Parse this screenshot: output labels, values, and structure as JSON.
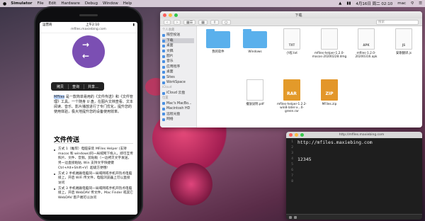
{
  "menubar": {
    "app_name": "Simulator",
    "items": [
      "File",
      "Edit",
      "Hardware",
      "Debug",
      "Window",
      "Help"
    ],
    "clock": "4月16日 周二 02:10",
    "user": "mac"
  },
  "phone": {
    "status_carrier": "运营商",
    "status_time": "上午2:10",
    "url": "mfiles.maxiebing.com",
    "popup": [
      "拷贝",
      "查询",
      "共享..."
    ],
    "intro_selected": "MFiles",
    "intro_text": " 是一款简单易用的《文件传送》和《文件管理》工具。一个随身 U 盘，在图片文档查看、文本阅读、音乐、影片播放进行了专门优化，提升您的使用体验，极大地提升您的设备使用效率。",
    "section_title": "文件传送",
    "steps": [
      "方式 1（推荐）电脑安装 MFiles Helper (支持 macos 和 windows)同一局域网下拖入，即可互传照片、文件、音频。剪贴板（一边拷贝文字发送，另一边直接粘贴, Win 支持文字快捷键 Ctrl+Alt+Shift+V）超级方便哦!",
      "方式 2 手机端跟电脑同一局域网或手机开热点电脑接上，开启 WiFi 传文件，电脑浏览器上可以直接访问",
      "方式 3 手机端跟电脑同一局域网或手机开热点电脑接上，开启 WebDAV 传文件，Mac Finder 或其它WebDAV 客户端可以访问"
    ]
  },
  "finder": {
    "title": "下载",
    "search_placeholder": "搜索",
    "sidebar": [
      {
        "label": "个人收藏",
        "section": true
      },
      {
        "label": "隔空投送",
        "icon": "airdrop-icon"
      },
      {
        "label": "下载",
        "icon": "download-icon",
        "selected": true
      },
      {
        "label": "桌面",
        "icon": "desktop-icon"
      },
      {
        "label": "文稿",
        "icon": "document-icon"
      },
      {
        "label": "图片",
        "icon": "picture-icon"
      },
      {
        "label": "音乐",
        "icon": "music-icon"
      },
      {
        "label": "应用程序",
        "icon": "app-icon"
      },
      {
        "label": "桌面",
        "icon": "desktop-icon"
      },
      {
        "label": "Sites",
        "icon": "folder-icon"
      },
      {
        "label": "WorkSpace",
        "icon": "folder-icon"
      },
      {
        "label": "iCloud",
        "section": true
      },
      {
        "label": "iCloud 云盘",
        "icon": "cloud-icon"
      },
      {
        "label": "位置",
        "section": true
      },
      {
        "label": "Mac's MacBo...",
        "icon": "laptop-icon"
      },
      {
        "label": "Macintosh HD",
        "icon": "disk-icon"
      },
      {
        "label": "远程光盘",
        "icon": "disc-icon"
      },
      {
        "label": "网络",
        "icon": "network-icon"
      }
    ],
    "files": [
      {
        "name": "我的软件",
        "kind": "folder"
      },
      {
        "name": "Windows",
        "kind": "folder"
      },
      {
        "name": "小程.txt",
        "kind": "doc",
        "badge": "TXT"
      },
      {
        "name": "mfiles-helper-1.2.0-macos-20200228.dmg",
        "kind": "dmg"
      },
      {
        "name": "mfiles-1.2.0-20200316.apk",
        "kind": "doc",
        "badge": "APK"
      },
      {
        "name": "安歌翻译.js",
        "kind": "doc",
        "badge": "JS"
      },
      {
        "name": "播放说明.pdf",
        "kind": "pdf"
      },
      {
        "name": "mfiles-helper-1.2.2-win8-later-x...0-green.rar",
        "kind": "rar",
        "badge": "RAR"
      },
      {
        "name": "MFiles.zip",
        "kind": "zip",
        "badge": "ZIP"
      }
    ]
  },
  "terminal": {
    "title": "http://mfiles.maxiebing.com",
    "lines": [
      "http://mfiles.maxiebing.com",
      "",
      "",
      "12345"
    ],
    "line_numbers": [
      "1",
      "2",
      "3",
      "4",
      "5",
      "6",
      "7",
      "8"
    ]
  },
  "colors": {
    "accent": "#4a90e2",
    "hero": "#7b4fb3",
    "terminal_bg": "#1e1e1e"
  }
}
